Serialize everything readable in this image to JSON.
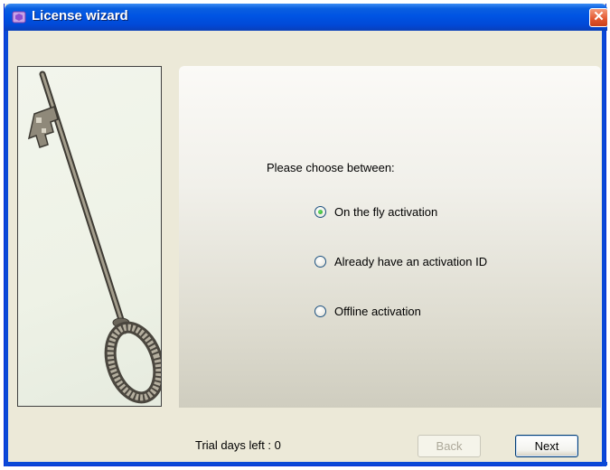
{
  "window": {
    "title": "License wizard",
    "close_label": "✕",
    "icon": "license-wizard-app-icon",
    "colors": {
      "titlebar": "#0054e3",
      "close": "#e1552d",
      "face": "#ece9d8"
    }
  },
  "illustration": {
    "icon": "key-icon"
  },
  "content": {
    "prompt": "Please choose between:",
    "options": [
      {
        "label": "On the fly activation",
        "selected": true
      },
      {
        "label": "Already have an activation ID",
        "selected": false
      },
      {
        "label": "Offline activation",
        "selected": false
      }
    ]
  },
  "footer": {
    "trial_text": "Trial days left : 0",
    "back_label": "Back",
    "back_enabled": false,
    "next_label": "Next"
  }
}
